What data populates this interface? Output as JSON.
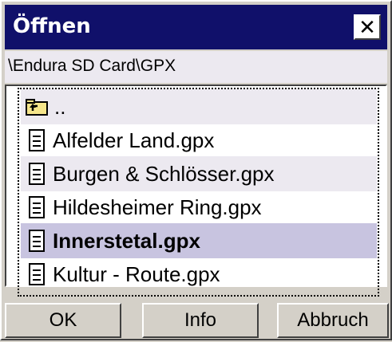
{
  "window": {
    "title": "Öffnen",
    "close_label": "✕"
  },
  "path": "\\Endura SD Card\\GPX",
  "files": [
    {
      "name": "..",
      "type": "parent-folder"
    },
    {
      "name": "Alfelder Land.gpx",
      "type": "file"
    },
    {
      "name": "Burgen & Schlösser.gpx",
      "type": "file"
    },
    {
      "name": "Hildesheimer Ring.gpx",
      "type": "file"
    },
    {
      "name": "Innerstetal.gpx",
      "type": "file",
      "selected": true
    },
    {
      "name": "Kultur - Route.gpx",
      "type": "file"
    }
  ],
  "buttons": {
    "ok": "OK",
    "info": "Info",
    "cancel": "Abbruch"
  },
  "colors": {
    "titlebar": "#10106a",
    "selected_row": "#c8c4e0",
    "alt_row": "#ece9f0",
    "face": "#d4d0c8"
  }
}
